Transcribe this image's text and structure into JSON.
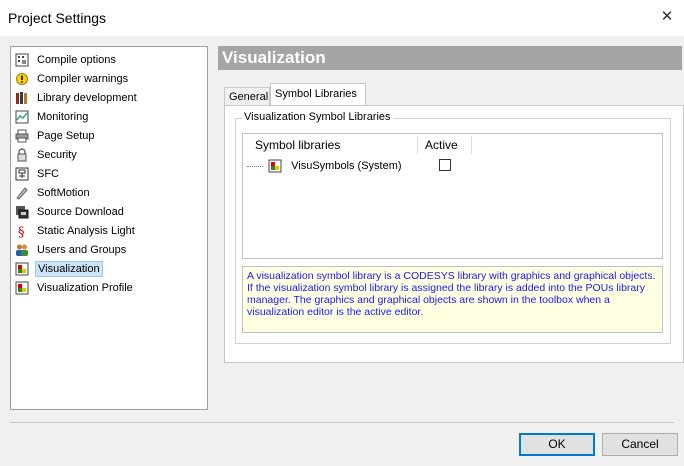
{
  "window": {
    "title": "Project Settings",
    "close_glyph": "✕"
  },
  "sidebar": {
    "items": [
      {
        "label": "Compile options",
        "icon": "compile-options-icon"
      },
      {
        "label": "Compiler warnings",
        "icon": "warning-icon"
      },
      {
        "label": "Library development",
        "icon": "library-books-icon"
      },
      {
        "label": "Monitoring",
        "icon": "monitor-icon"
      },
      {
        "label": "Page Setup",
        "icon": "printer-icon"
      },
      {
        "label": "Security",
        "icon": "lock-icon"
      },
      {
        "label": "SFC",
        "icon": "sfc-icon"
      },
      {
        "label": "SoftMotion",
        "icon": "softmotion-icon"
      },
      {
        "label": "Source Download",
        "icon": "source-download-icon"
      },
      {
        "label": "Static Analysis Light",
        "icon": "section-sign-icon"
      },
      {
        "label": "Users and Groups",
        "icon": "users-icon"
      },
      {
        "label": "Visualization",
        "icon": "visualization-icon",
        "selected": true
      },
      {
        "label": "Visualization Profile",
        "icon": "visualization-profile-icon"
      }
    ]
  },
  "main": {
    "header": "Visualization",
    "tabs": [
      {
        "label": "General",
        "active": false
      },
      {
        "label": "Symbol Libraries",
        "active": true
      }
    ],
    "group_title": "Visualization Symbol Libraries",
    "table": {
      "columns": [
        "Symbol libraries",
        "Active"
      ],
      "rows": [
        {
          "name": "VisuSymbols (System)",
          "active": false
        }
      ]
    },
    "info_text": "A visualization symbol library is a CODESYS library with graphics and graphical objects. If the visualization symbol library is assigned the library is added into the POUs library manager. The graphics and graphical objects are shown in the toolbox when a visualization editor is the active editor."
  },
  "footer": {
    "ok_label": "OK",
    "cancel_label": "Cancel"
  },
  "colors": {
    "header_bg": "#a5a5a5",
    "selection": "#cce4f7",
    "info_bg": "#ffffe1",
    "info_text": "#1a1aff",
    "default_button_border": "#0078d7"
  }
}
